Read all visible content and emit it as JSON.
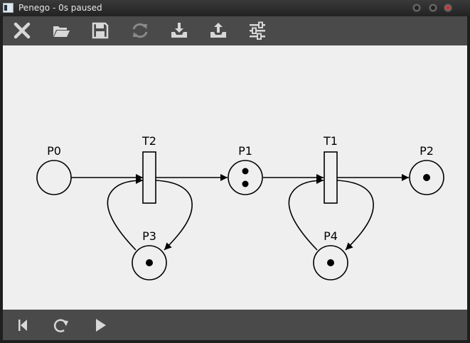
{
  "window": {
    "title": "Penego - 0s paused"
  },
  "toolbar": {
    "buttons": [
      {
        "name": "close-icon",
        "enabled": true
      },
      {
        "name": "folder-open-icon",
        "enabled": true
      },
      {
        "name": "save-icon",
        "enabled": true
      },
      {
        "name": "reload-icon",
        "enabled": false
      },
      {
        "name": "import-icon",
        "enabled": true
      },
      {
        "name": "export-icon",
        "enabled": true
      },
      {
        "name": "settings-sliders-icon",
        "enabled": true
      }
    ]
  },
  "petri_net": {
    "places": [
      {
        "id": "P0",
        "label": "P0",
        "tokens": 0
      },
      {
        "id": "P1",
        "label": "P1",
        "tokens": 2
      },
      {
        "id": "P2",
        "label": "P2",
        "tokens": 1
      },
      {
        "id": "P3",
        "label": "P3",
        "tokens": 1
      },
      {
        "id": "P4",
        "label": "P4",
        "tokens": 1
      }
    ],
    "transitions": [
      {
        "id": "T2",
        "label": "T2"
      },
      {
        "id": "T1",
        "label": "T1"
      }
    ],
    "arcs": [
      {
        "from": "P0",
        "to": "T2"
      },
      {
        "from": "T2",
        "to": "P1"
      },
      {
        "from": "T2",
        "to": "P3"
      },
      {
        "from": "P3",
        "to": "T2"
      },
      {
        "from": "P1",
        "to": "T1"
      },
      {
        "from": "T1",
        "to": "P2"
      },
      {
        "from": "T1",
        "to": "P4"
      },
      {
        "from": "P4",
        "to": "T1"
      }
    ]
  },
  "bottombar": {
    "buttons": [
      {
        "name": "skip-to-start-icon"
      },
      {
        "name": "redo-icon"
      },
      {
        "name": "play-icon"
      }
    ]
  },
  "colors": {
    "toolbar_bg": "#4a4a4a",
    "canvas_bg": "#efefef",
    "icon": "#d8d8d8",
    "icon_disabled": "#8a8a8a"
  }
}
